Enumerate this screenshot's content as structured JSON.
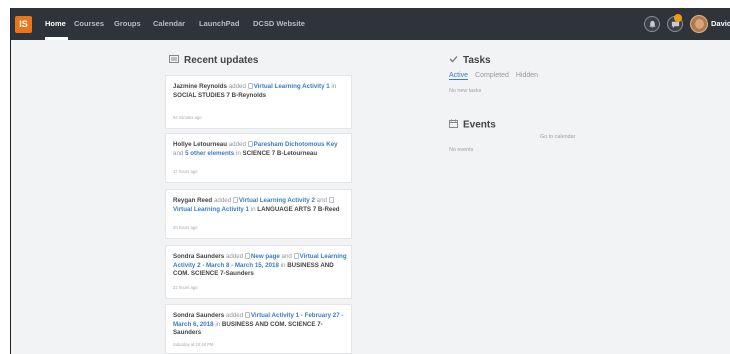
{
  "nav": {
    "logo_text": "IS",
    "items": [
      "Home",
      "Courses",
      "Groups",
      "Calendar",
      "LaunchPad",
      "DCSD Website"
    ],
    "active": "Home",
    "user_name": "David",
    "icons": [
      "logo-icon",
      "notifications-bell-icon",
      "messages-icon",
      "avatar"
    ],
    "accent_color": "#e9761c",
    "bar_color": "#2f343b"
  },
  "recent_updates": {
    "title": "Recent updates",
    "items": [
      {
        "author": "Jazmine Reynolds",
        "verb": "added",
        "link1": "Virtual Learning Activity 1",
        "prep": "in",
        "course": "SOCIAL STUDIES 7 B-Reynolds",
        "time": "54 minutes ago"
      },
      {
        "author": "Hollye Letourneau",
        "verb": "added",
        "link1": "Paresham Dichotomous Key",
        "and": "and",
        "link2": "5 other elements",
        "prep": "in",
        "course": "SCIENCE 7 B-Letourneau",
        "time": "17 hours ago"
      },
      {
        "author": "Reygan Reed",
        "verb": "added",
        "link1": "Virtual Learning Activity 2",
        "and": "and",
        "link2": "Virtual Learning Activity 1",
        "prep": "in",
        "course": "LANGUAGE ARTS 7 B-Reed",
        "time": "20 hours ago"
      },
      {
        "author": "Sondra Saunders",
        "verb": "added",
        "link1": "New page",
        "and": "and",
        "link2": "Virtual Learning Activity 2 - March 8 - March 15, 2018",
        "prep": "in",
        "course": "BUSINESS AND COM. SCIENCE 7-Saunders",
        "time": "22 hours ago"
      },
      {
        "author": "Sondra Saunders",
        "verb": "added",
        "link1": "Virtual Activity 1 - February 27 - March 6, 2018",
        "prep": "in",
        "course": "BUSINESS AND COM. SCIENCE 7-Saunders",
        "time": "Saturday at 10:40 PM"
      }
    ]
  },
  "tasks": {
    "title": "Tasks",
    "tabs": [
      "Active",
      "Completed",
      "Hidden"
    ],
    "active_tab": "Active",
    "empty_text": "No new tasks"
  },
  "events": {
    "title": "Events",
    "calendar_link": "Go to calendar",
    "empty_text": "No events"
  }
}
